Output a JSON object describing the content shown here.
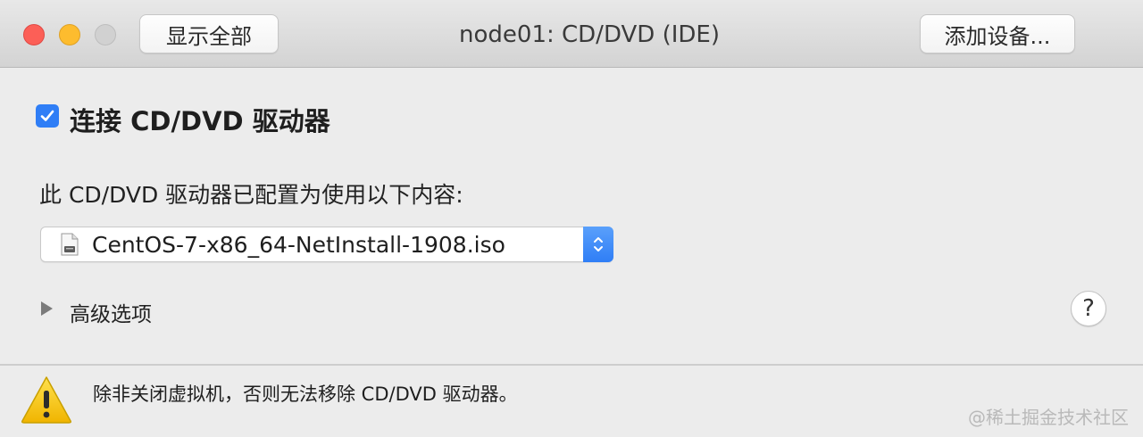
{
  "titlebar": {
    "title": "node01: CD/DVD (IDE)",
    "show_all_label": "显示全部",
    "add_device_label": "添加设备..."
  },
  "connect": {
    "label": "连接 CD/DVD 驱动器",
    "checked": true
  },
  "config": {
    "description": "此 CD/DVD 驱动器已配置为使用以下内容:",
    "selected_file": "CentOS-7-x86_64-NetInstall-1908.iso",
    "file_icon": "disk-image-icon"
  },
  "advanced": {
    "label": "高级选项",
    "expanded": false
  },
  "help": {
    "label": "?"
  },
  "warning": {
    "icon": "warning-icon",
    "text": "除非关闭虚拟机，否则无法移除 CD/DVD 驱动器。"
  },
  "watermark": "@稀土掘金技术社区",
  "colors": {
    "accent": "#2f7ef6",
    "close": "#fc5f57",
    "minimize": "#fdbc2e",
    "warning": "#f5c400"
  }
}
